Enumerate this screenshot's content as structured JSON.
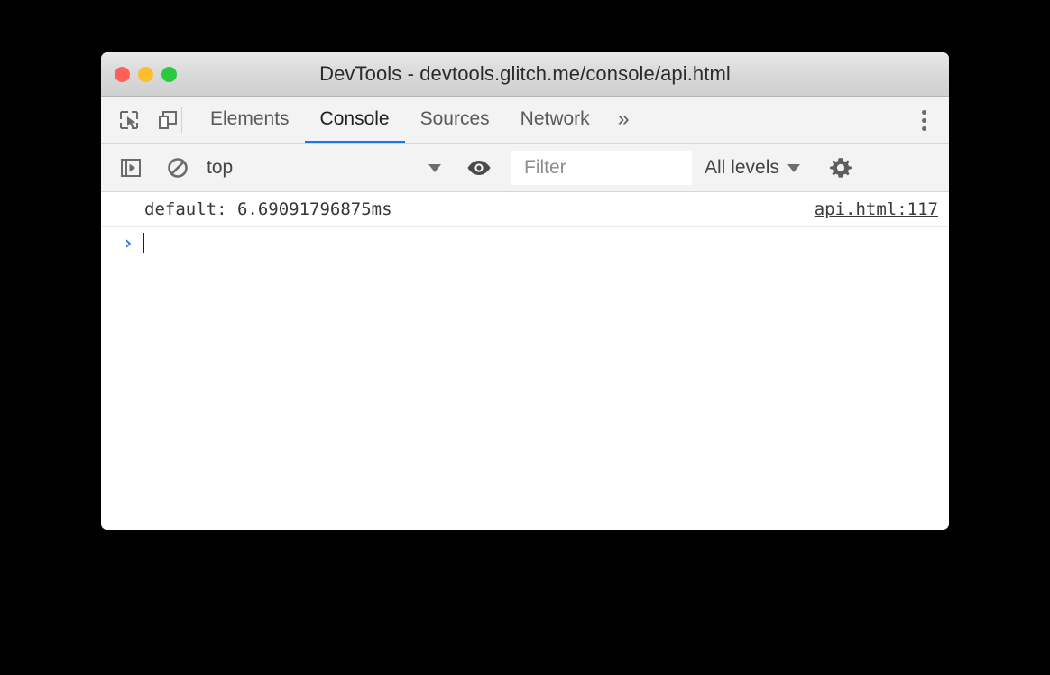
{
  "window": {
    "title": "DevTools - devtools.glitch.me/console/api.html",
    "traffic_lights": [
      {
        "name": "close",
        "color": "#ff6058"
      },
      {
        "name": "minimize",
        "color": "#ffbd2e"
      },
      {
        "name": "zoom",
        "color": "#2ac940"
      }
    ]
  },
  "tabbar": {
    "icons": [
      {
        "name": "inspect-element-icon"
      },
      {
        "name": "device-toolbar-icon"
      }
    ],
    "tabs": [
      {
        "label": "Elements",
        "active": false
      },
      {
        "label": "Console",
        "active": true
      },
      {
        "label": "Sources",
        "active": false
      },
      {
        "label": "Network",
        "active": false
      }
    ],
    "overflow_label": "»",
    "more_options": "kebab-menu-icon",
    "active_accent": "#1a73e8"
  },
  "console_toolbar": {
    "sidebar_toggle": "console-sidebar-icon",
    "clear_console": "clear-console-icon",
    "context": {
      "value": "top",
      "options": [
        "top"
      ]
    },
    "live_expression": "eye-icon",
    "filter": {
      "value": "",
      "placeholder": "Filter"
    },
    "levels": {
      "value": "All levels",
      "options": [
        "All levels"
      ]
    },
    "settings": "gear-icon"
  },
  "console_body": {
    "messages": [
      {
        "text": "default: 6.69091796875ms",
        "source": "api.html:117"
      }
    ],
    "prompt": {
      "chevron": "›",
      "value": ""
    }
  }
}
